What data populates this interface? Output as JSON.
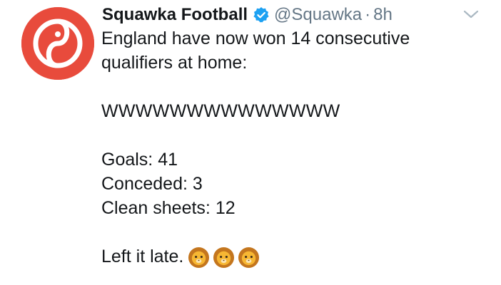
{
  "author": {
    "name": "Squawka Football",
    "handle": "@Squawka",
    "separator": "·",
    "time": "8h",
    "avatar_icon": "squawka-logo-icon",
    "verified_icon": "verified-badge-icon",
    "avatar_color": "#e84b3c",
    "verified_color": "#1da1f2"
  },
  "menu_icon": "chevron-down-icon",
  "tweet": {
    "line1": "England have now won 14 consecutive",
    "line2": "qualifiers at home:",
    "wins": "WWWWWWWWWWWWWW",
    "goals": "Goals: 41",
    "conceded": "Conceded: 3",
    "clean_sheets": "Clean sheets: 12",
    "closing": "Left it late.",
    "emoji_icons": [
      "lion-face-icon",
      "lion-face-icon",
      "lion-face-icon"
    ]
  }
}
